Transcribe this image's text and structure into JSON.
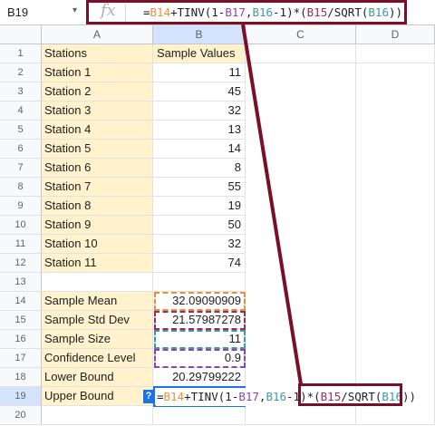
{
  "name_box": "B19",
  "formula_bar": {
    "fx_label": "fx",
    "parts": {
      "p1": "=",
      "p2": "B14",
      "p3": "+TINV(1-",
      "p4": "B17",
      "p5": ",",
      "p6": "B16",
      "p7": "-1)*(",
      "p8": "B15",
      "p9": "/SQRT(",
      "p10": "B16",
      "p11": "))"
    }
  },
  "columns": [
    "A",
    "B",
    "C",
    "D"
  ],
  "rows": [
    "1",
    "2",
    "3",
    "4",
    "5",
    "6",
    "7",
    "8",
    "9",
    "10",
    "11",
    "12",
    "13",
    "14",
    "15",
    "16",
    "17",
    "18",
    "19",
    "20"
  ],
  "table": {
    "header_a": "Stations",
    "header_b": "Sample Values",
    "stations": [
      {
        "name": "Station 1",
        "value": "11"
      },
      {
        "name": "Station 2",
        "value": "45"
      },
      {
        "name": "Station 3",
        "value": "32"
      },
      {
        "name": "Station 4",
        "value": "13"
      },
      {
        "name": "Station 5",
        "value": "14"
      },
      {
        "name": "Station 6",
        "value": "8"
      },
      {
        "name": "Station 7",
        "value": "55"
      },
      {
        "name": "Station 8",
        "value": "19"
      },
      {
        "name": "Station 9",
        "value": "50"
      },
      {
        "name": "Station 10",
        "value": "32"
      },
      {
        "name": "Station 11",
        "value": "74"
      }
    ]
  },
  "stats": [
    {
      "label": "Sample Mean",
      "value": "32.09090909"
    },
    {
      "label": "Sample Std Dev",
      "value": "21.57987278"
    },
    {
      "label": "Sample Size",
      "value": "11"
    },
    {
      "label": "Confidence Level",
      "value": "0.9"
    },
    {
      "label": "Lower Bound",
      "value": "20.29799222"
    },
    {
      "label": "Upper Bound",
      "value": ""
    }
  ],
  "cell_editor": {
    "help_badge": "?",
    "parts": {
      "p1": "=",
      "p2": "B14",
      "p3": "+TINV(1-",
      "p4": "B17",
      "p5": ",",
      "p6": "B16",
      "p7": "-1)*(",
      "p8": "B15",
      "p9": "/SQRT(",
      "p10": "B16",
      "p11": "))"
    }
  },
  "colors": {
    "mean_ref": "#e69138",
    "stddev_ref": "#9d2a5c",
    "size_ref": "#3a9aa8",
    "confidence_ref": "#8e44ad",
    "highlight_annotation": "#7a1028",
    "label_fill": "#fff2cc"
  }
}
